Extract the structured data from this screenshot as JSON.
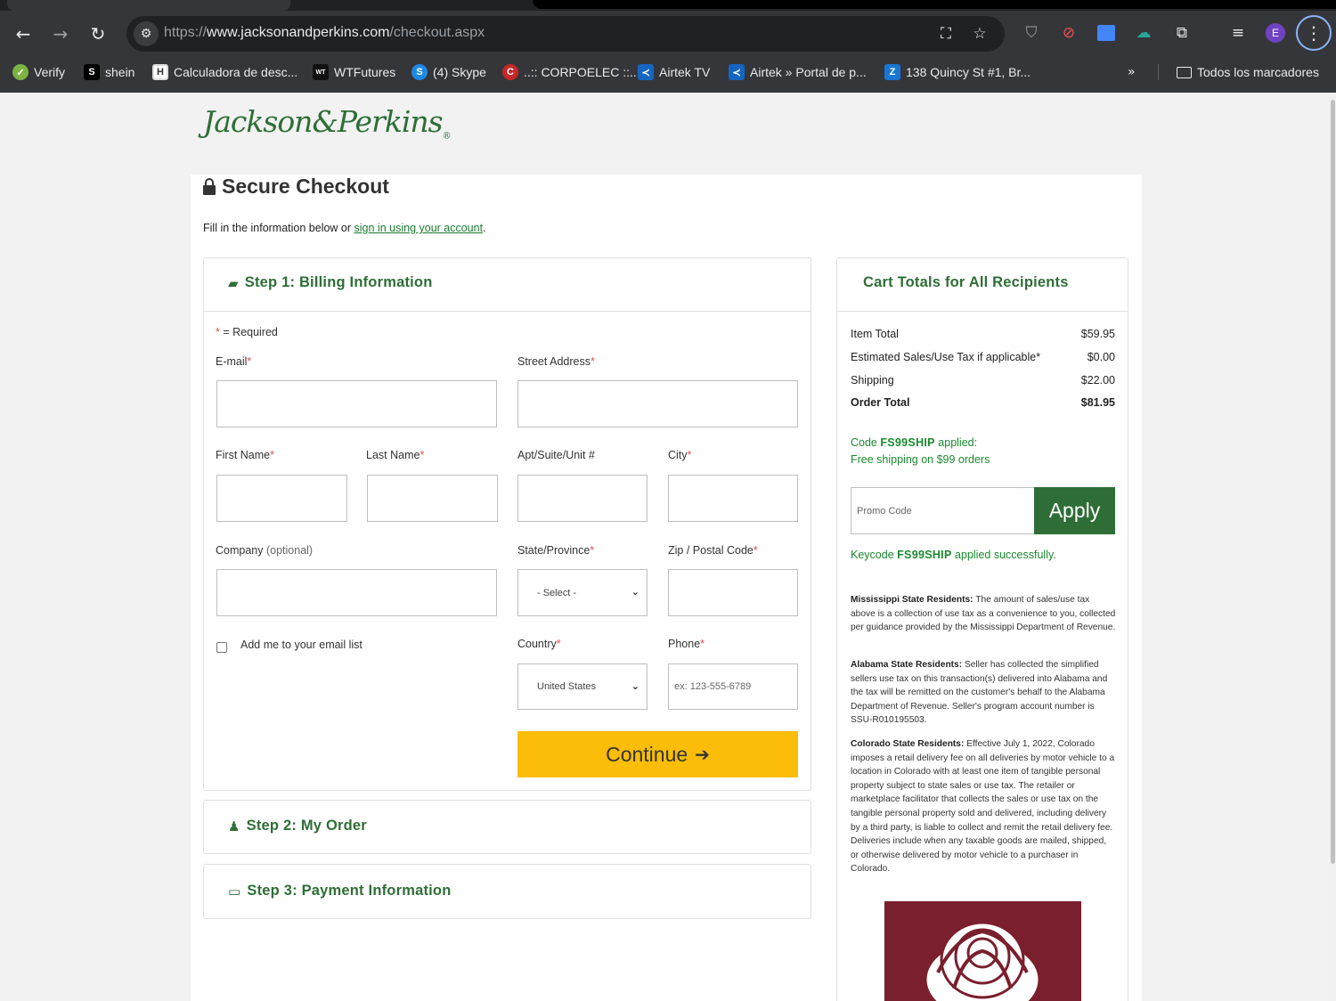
{
  "browser": {
    "url_scheme": "https://",
    "url_host": "www.jacksonandperkins.com",
    "url_path": "/checkout.aspx",
    "profile_initial": "E",
    "bookmarks": [
      {
        "label": "Verify",
        "icon": "verify-icon",
        "color": "#7cb342"
      },
      {
        "label": "shein",
        "icon": "shein-icon",
        "color": "#000000"
      },
      {
        "label": "Calculadora de desc...",
        "icon": "calculator-icon",
        "color": "#444444"
      },
      {
        "label": "WTFutures",
        "icon": "wtfutures-icon",
        "color": "#111111"
      },
      {
        "label": "(4) Skype",
        "icon": "skype-icon",
        "color": "#1e88e5"
      },
      {
        "label": "..:: CORPOELEC ::..",
        "icon": "corpoelec-icon",
        "color": "#c62828"
      },
      {
        "label": "Airtek TV",
        "icon": "airtek-icon",
        "color": "#1565c0"
      },
      {
        "label": "Airtek » Portal de p...",
        "icon": "airtek-icon",
        "color": "#1565c0"
      },
      {
        "label": "138 Quincy St #1, Br...",
        "icon": "zillow-icon",
        "color": "#1976d2"
      }
    ],
    "all_bookmarks_label": "Todos los marcadores"
  },
  "brand": {
    "logo_text": "Jackson&Perkins",
    "logo_mark": "®"
  },
  "header": {
    "title": "Secure Checkout",
    "intro_prefix": "Fill in the information below or ",
    "intro_link": "sign in using your account",
    "intro_suffix": "."
  },
  "billing": {
    "step_title": "Step 1: Billing Information",
    "required_note": "= Required",
    "required_mark": "*",
    "email_label": "E-mail",
    "street_label": "Street Address",
    "first_name_label": "First Name",
    "last_name_label": "Last Name",
    "apt_label": "Apt/Suite/Unit #",
    "city_label": "City",
    "company_label": "Company",
    "company_optional": "(optional)",
    "state_label": "State/Province",
    "state_value": "- Select -",
    "zip_label": "Zip / Postal Code",
    "email_list_label": "Add me to your email list",
    "country_label": "Country",
    "country_value": "United States",
    "phone_label": "Phone",
    "phone_placeholder": "ex: 123-555-6789",
    "continue_label": "Continue"
  },
  "steps": {
    "step2_title": "Step 2: My Order",
    "step3_title": "Step 3: Payment Information"
  },
  "cart": {
    "title": "Cart Totals for All Recipients",
    "rows": [
      {
        "label": "Item Total",
        "value": "$59.95"
      },
      {
        "label": "Estimated Sales/Use Tax if applicable*",
        "value": "$0.00"
      },
      {
        "label": "Shipping",
        "value": "$22.00"
      },
      {
        "label": "Order Total",
        "value": "$81.95"
      }
    ],
    "code_applied_prefix": "Code ",
    "code": "FS99SHIP",
    "code_applied_suffix": " applied:",
    "code_description": "Free shipping on $99 orders",
    "promo_placeholder": "Promo Code",
    "apply_label": "Apply",
    "keycode_prefix": "Keycode ",
    "keycode_suffix": " applied successfully.",
    "notices": [
      {
        "title": "Mississippi State Residents:",
        "text": " The amount of sales/use tax above is a collection of use tax as a convenience to you, collected per guidance provided by the Mississippi Department of Revenue."
      },
      {
        "title": "Alabama State Residents:",
        "text": " Seller has collected the simplified sellers use tax on this transaction(s) delivered into Alabama and the tax will be remitted on the customer's behalf to the Alabama Department of Revenue. Seller's program account number is SSU-R010195503."
      },
      {
        "title": "Colorado State Residents:",
        "text": " Effective July 1, 2022, Colorado imposes a retail delivery fee on all deliveries by motor vehicle to a location in Colorado with at least one item of tangible personal property subject to state sales or use tax. The retailer or marketplace facilitator that collects the sales or use tax on the tangible personal property sold and delivered, including delivery by a third party, is liable to collect and remit the retail delivery fee. Deliveries include when any taxable goods are mailed, shipped, or otherwise delivered by motor vehicle to a purchaser in Colorado."
      }
    ]
  },
  "colors": {
    "brand_green": "#2e6e36",
    "continue_yellow": "#fbbd08",
    "rose_bg": "#7a1f2d"
  }
}
